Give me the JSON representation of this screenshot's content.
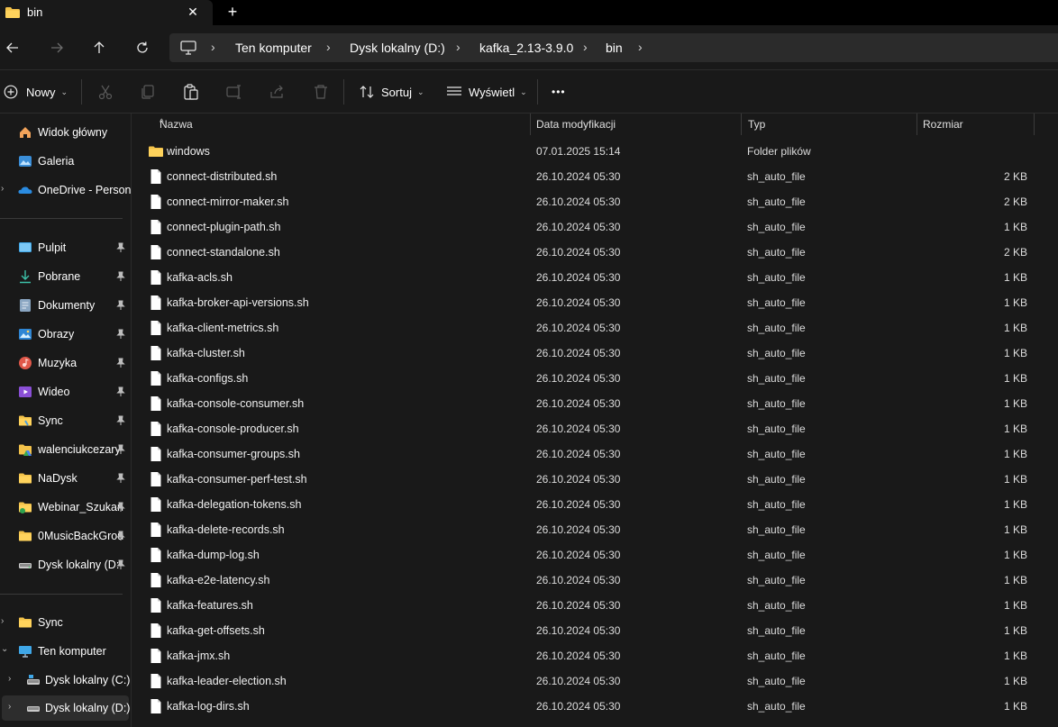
{
  "tab": {
    "title": "bin"
  },
  "address": {
    "crumbs": [
      "Ten komputer",
      "Dysk lokalny (D:)",
      "kafka_2.13-3.9.0",
      "bin"
    ]
  },
  "toolbar": {
    "new_label": "Nowy",
    "sort_label": "Sortuj",
    "view_label": "Wyświetl",
    "more_label": "•••"
  },
  "sidebar": {
    "quick": [
      {
        "label": "Widok główny",
        "icon": "home-icon"
      },
      {
        "label": "Galeria",
        "icon": "gallery-icon"
      },
      {
        "label": "OneDrive - Persona",
        "icon": "onedrive-icon"
      }
    ],
    "pinned": [
      {
        "label": "Pulpit",
        "icon": "desktop-icon"
      },
      {
        "label": "Pobrane",
        "icon": "downloads-icon"
      },
      {
        "label": "Dokumenty",
        "icon": "documents-icon"
      },
      {
        "label": "Obrazy",
        "icon": "pictures-icon"
      },
      {
        "label": "Muzyka",
        "icon": "music-icon"
      },
      {
        "label": "Wideo",
        "icon": "videos-icon"
      },
      {
        "label": "Sync",
        "icon": "folder-icon"
      },
      {
        "label": "walenciukcezary",
        "icon": "google-drive-icon"
      },
      {
        "label": "NaDysk",
        "icon": "folder-icon"
      },
      {
        "label": "Webinar_Szukan",
        "icon": "shared-folder-icon"
      },
      {
        "label": "0MusicBackGrou",
        "icon": "folder-icon"
      },
      {
        "label": "Dysk lokalny (D:",
        "icon": "drive-icon"
      }
    ],
    "tree": [
      {
        "label": "Sync",
        "icon": "folder-icon"
      },
      {
        "label": "Ten komputer",
        "icon": "computer-icon"
      },
      {
        "label": "Dysk lokalny (C:)",
        "icon": "drive-icon"
      },
      {
        "label": "Dysk lokalny (D:)",
        "icon": "drive-icon"
      }
    ]
  },
  "columns": {
    "name": "Nazwa",
    "date": "Data modyfikacji",
    "type": "Typ",
    "size": "Rozmiar"
  },
  "files": [
    {
      "name": "windows",
      "date": "07.01.2025 15:14",
      "type": "Folder plików",
      "size": "",
      "icon": "folder-icon"
    },
    {
      "name": "connect-distributed.sh",
      "date": "26.10.2024 05:30",
      "type": "sh_auto_file",
      "size": "2 KB",
      "icon": "file-icon"
    },
    {
      "name": "connect-mirror-maker.sh",
      "date": "26.10.2024 05:30",
      "type": "sh_auto_file",
      "size": "2 KB",
      "icon": "file-icon"
    },
    {
      "name": "connect-plugin-path.sh",
      "date": "26.10.2024 05:30",
      "type": "sh_auto_file",
      "size": "1 KB",
      "icon": "file-icon"
    },
    {
      "name": "connect-standalone.sh",
      "date": "26.10.2024 05:30",
      "type": "sh_auto_file",
      "size": "2 KB",
      "icon": "file-icon"
    },
    {
      "name": "kafka-acls.sh",
      "date": "26.10.2024 05:30",
      "type": "sh_auto_file",
      "size": "1 KB",
      "icon": "file-icon"
    },
    {
      "name": "kafka-broker-api-versions.sh",
      "date": "26.10.2024 05:30",
      "type": "sh_auto_file",
      "size": "1 KB",
      "icon": "file-icon"
    },
    {
      "name": "kafka-client-metrics.sh",
      "date": "26.10.2024 05:30",
      "type": "sh_auto_file",
      "size": "1 KB",
      "icon": "file-icon"
    },
    {
      "name": "kafka-cluster.sh",
      "date": "26.10.2024 05:30",
      "type": "sh_auto_file",
      "size": "1 KB",
      "icon": "file-icon"
    },
    {
      "name": "kafka-configs.sh",
      "date": "26.10.2024 05:30",
      "type": "sh_auto_file",
      "size": "1 KB",
      "icon": "file-icon"
    },
    {
      "name": "kafka-console-consumer.sh",
      "date": "26.10.2024 05:30",
      "type": "sh_auto_file",
      "size": "1 KB",
      "icon": "file-icon"
    },
    {
      "name": "kafka-console-producer.sh",
      "date": "26.10.2024 05:30",
      "type": "sh_auto_file",
      "size": "1 KB",
      "icon": "file-icon"
    },
    {
      "name": "kafka-consumer-groups.sh",
      "date": "26.10.2024 05:30",
      "type": "sh_auto_file",
      "size": "1 KB",
      "icon": "file-icon"
    },
    {
      "name": "kafka-consumer-perf-test.sh",
      "date": "26.10.2024 05:30",
      "type": "sh_auto_file",
      "size": "1 KB",
      "icon": "file-icon"
    },
    {
      "name": "kafka-delegation-tokens.sh",
      "date": "26.10.2024 05:30",
      "type": "sh_auto_file",
      "size": "1 KB",
      "icon": "file-icon"
    },
    {
      "name": "kafka-delete-records.sh",
      "date": "26.10.2024 05:30",
      "type": "sh_auto_file",
      "size": "1 KB",
      "icon": "file-icon"
    },
    {
      "name": "kafka-dump-log.sh",
      "date": "26.10.2024 05:30",
      "type": "sh_auto_file",
      "size": "1 KB",
      "icon": "file-icon"
    },
    {
      "name": "kafka-e2e-latency.sh",
      "date": "26.10.2024 05:30",
      "type": "sh_auto_file",
      "size": "1 KB",
      "icon": "file-icon"
    },
    {
      "name": "kafka-features.sh",
      "date": "26.10.2024 05:30",
      "type": "sh_auto_file",
      "size": "1 KB",
      "icon": "file-icon"
    },
    {
      "name": "kafka-get-offsets.sh",
      "date": "26.10.2024 05:30",
      "type": "sh_auto_file",
      "size": "1 KB",
      "icon": "file-icon"
    },
    {
      "name": "kafka-jmx.sh",
      "date": "26.10.2024 05:30",
      "type": "sh_auto_file",
      "size": "1 KB",
      "icon": "file-icon"
    },
    {
      "name": "kafka-leader-election.sh",
      "date": "26.10.2024 05:30",
      "type": "sh_auto_file",
      "size": "1 KB",
      "icon": "file-icon"
    },
    {
      "name": "kafka-log-dirs.sh",
      "date": "26.10.2024 05:30",
      "type": "sh_auto_file",
      "size": "1 KB",
      "icon": "file-icon"
    }
  ]
}
